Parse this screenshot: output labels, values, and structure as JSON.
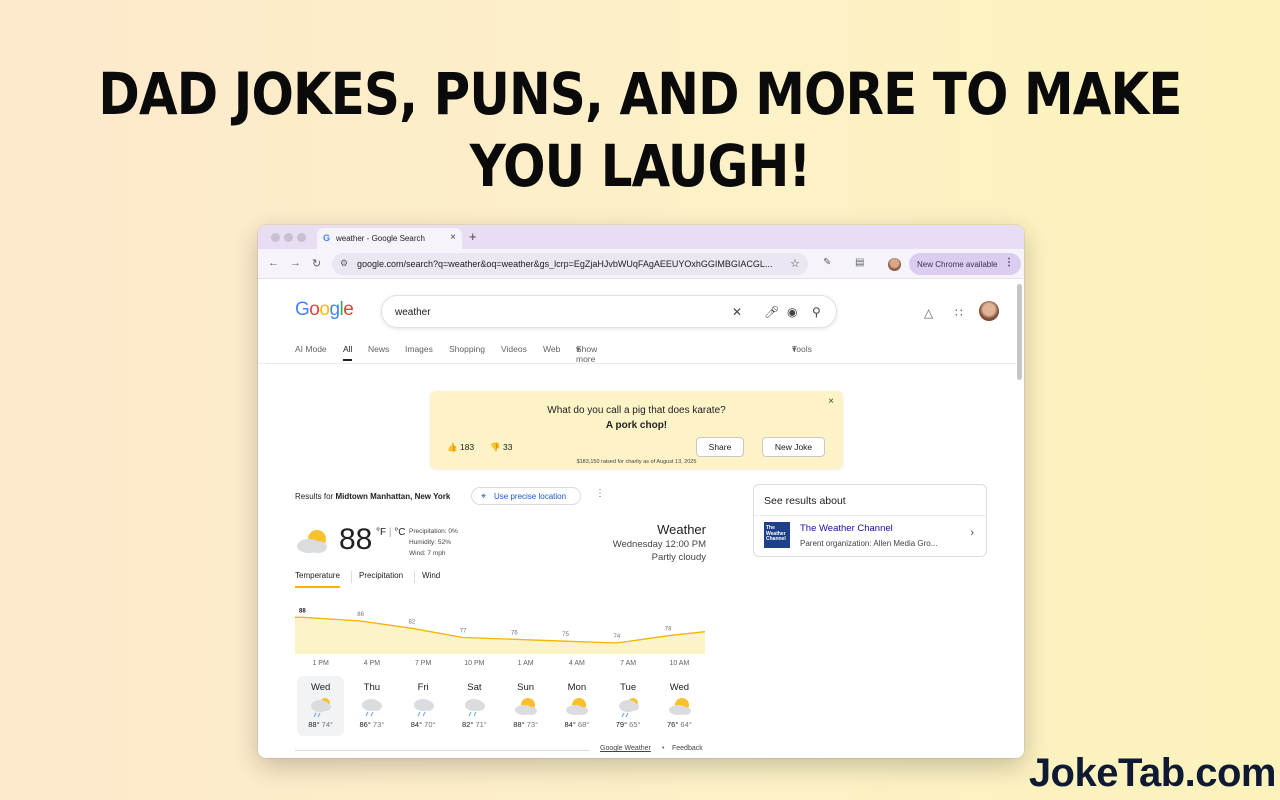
{
  "promo": {
    "headline_line1": "DAD JOKES, PUNS, AND MORE TO MAKE",
    "headline_line2": "YOU LAUGH!",
    "brand": "JokeTab.com"
  },
  "browser": {
    "tab_title": "weather - Google Search",
    "tab_favicon": "G",
    "tab_close": "×",
    "new_tab": "+",
    "url": "google.com/search?q=weather&oq=weather&gs_lcrp=EgZjaHJvbWUqFAgAEEUYOxhGGIMBGIACGL...",
    "chrome_update": "New Chrome available",
    "icons": [
      "back-icon",
      "forward-icon",
      "reload-icon",
      "tune-icon",
      "star-icon",
      "extensions-icon",
      "tab-search-icon",
      "profile-avatar",
      "kebab-menu-icon"
    ]
  },
  "search": {
    "logo": "Google",
    "query": "weather",
    "tabs": [
      "AI Mode",
      "All",
      "News",
      "Images",
      "Shopping",
      "Videos",
      "Web",
      "Show more",
      "Tools"
    ],
    "active_tab": "All"
  },
  "joke": {
    "question": "What do you call a pig that does karate?",
    "answer": "A pork chop!",
    "thumbs_up_count": "183",
    "thumbs_down_count": "33",
    "share_label": "Share",
    "new_joke_label": "New Joke",
    "charity_text": "$183,150 raised for charity as of August 13, 2025",
    "close": "×"
  },
  "weather": {
    "results_prefix": "Results for ",
    "location": "Midtown Manhattan, New York",
    "precise_location_label": "Use precise location",
    "temperature": "88",
    "unit_f": "°F",
    "unit_c": "°C",
    "precipitation": "Precipitation: 0%",
    "humidity": "Humidity: 52%",
    "wind": "Wind: 7 mph",
    "title": "Weather",
    "datetime": "Wednesday 12:00 PM",
    "condition": "Partly cloudy",
    "tabs": [
      "Temperature",
      "Precipitation",
      "Wind"
    ],
    "active_tab": "Temperature",
    "hourly_temps": [
      88,
      86,
      82,
      77,
      76,
      75,
      74,
      78
    ],
    "hour_labels": [
      "1 PM",
      "4 PM",
      "7 PM",
      "10 PM",
      "1 AM",
      "4 AM",
      "7 AM",
      "10 AM"
    ],
    "days": [
      {
        "name": "Wed",
        "icon": "rain-sun-icon",
        "high": "88°",
        "low": "74°"
      },
      {
        "name": "Thu",
        "icon": "rain-icon",
        "high": "86°",
        "low": "73°"
      },
      {
        "name": "Fri",
        "icon": "rain-icon",
        "high": "84°",
        "low": "70°"
      },
      {
        "name": "Sat",
        "icon": "rain-icon",
        "high": "82°",
        "low": "71°"
      },
      {
        "name": "Sun",
        "icon": "partly-cloudy-icon",
        "high": "88°",
        "low": "73°"
      },
      {
        "name": "Mon",
        "icon": "partly-cloudy-icon",
        "high": "84°",
        "low": "68°"
      },
      {
        "name": "Tue",
        "icon": "rain-sun-icon",
        "high": "79°",
        "low": "65°"
      },
      {
        "name": "Wed",
        "icon": "partly-cloudy-icon",
        "high": "76°",
        "low": "64°"
      }
    ],
    "source": "Google Weather",
    "separator": "•",
    "feedback": "Feedback"
  },
  "knowledge": {
    "header": "See results about",
    "name": "The Weather Channel",
    "org": "Parent organization: Allen Media Gro...",
    "logo_text": "The Weather Channel"
  },
  "colors": {
    "accent_yellow": "#f4b400",
    "chart_fill": "#fdf3c9",
    "link_blue": "#1a0dab",
    "chrome_purple": "#e9ddf3"
  }
}
